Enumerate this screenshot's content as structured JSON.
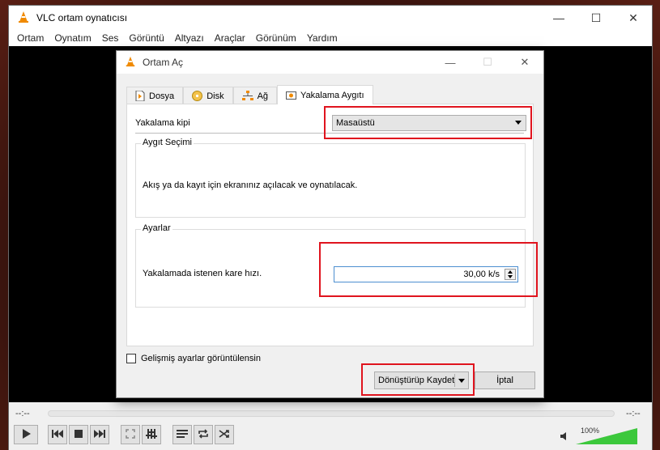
{
  "main_window": {
    "title": "VLC ortam oynatıcısı",
    "menu": [
      "Ortam",
      "Oynatım",
      "Ses",
      "Görüntü",
      "Altyazı",
      "Araçlar",
      "Görünüm",
      "Yardım"
    ],
    "controls": {
      "time_elapsed": "--:--",
      "time_remaining": "--:--",
      "volume": "100%",
      "volume_level": 1.0
    }
  },
  "dialog": {
    "title": "Ortam Aç",
    "tabs": [
      {
        "label": "Dosya",
        "icon": "file-icon"
      },
      {
        "label": "Disk",
        "icon": "disc-icon"
      },
      {
        "label": "Ağ",
        "icon": "network-icon"
      },
      {
        "label": "Yakalama Aygıtı",
        "icon": "capture-icon",
        "active": true
      }
    ],
    "capture_mode_label": "Yakalama kipi",
    "capture_mode_value": "Masaüstü",
    "device_group_title": "Aygıt Seçimi",
    "device_info": "Akış ya da kayıt için ekranınız açılacak ve oynatılacak.",
    "options_group_title": "Ayarlar",
    "frame_rate_label": "Yakalamada istenen kare hızı.",
    "frame_rate_value": "30,00 k/s",
    "advanced_checkbox_label": "Gelişmiş ayarlar görüntülensin",
    "convert_button": "Dönüştürüp Kaydet",
    "cancel_button": "İptal"
  },
  "colors": {
    "highlight": "#e0141e",
    "vlc_orange": "#f08a00",
    "volume_green": "#3cc83c"
  }
}
